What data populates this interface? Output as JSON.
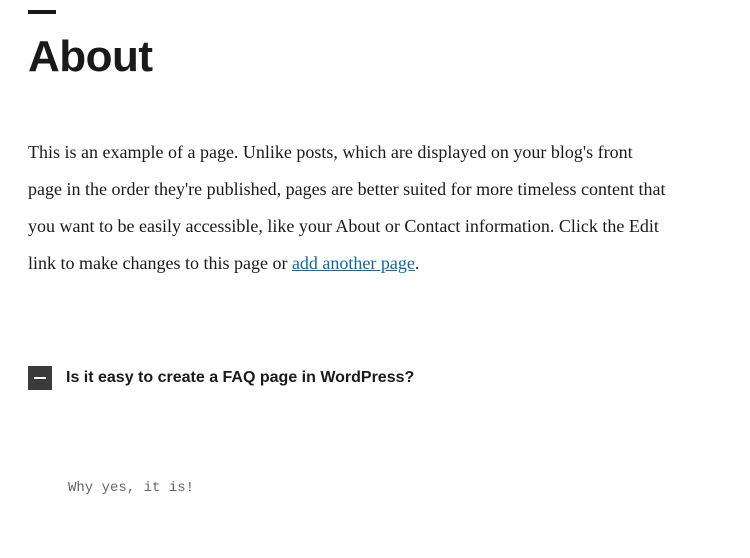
{
  "title": "About",
  "body": {
    "text_before_link": "This is an example of a page. Unlike posts, which are displayed on your blog's front page in the order they're published, pages are better suited for more timeless content that you want to be easily accessible, like your About or Contact information. Click the Edit link to make changes to this page or ",
    "link_text": "add another page",
    "text_after_link": "."
  },
  "faq": {
    "question": "Is it easy to create a FAQ page in WordPress?",
    "answer": "Why yes, it is!"
  }
}
